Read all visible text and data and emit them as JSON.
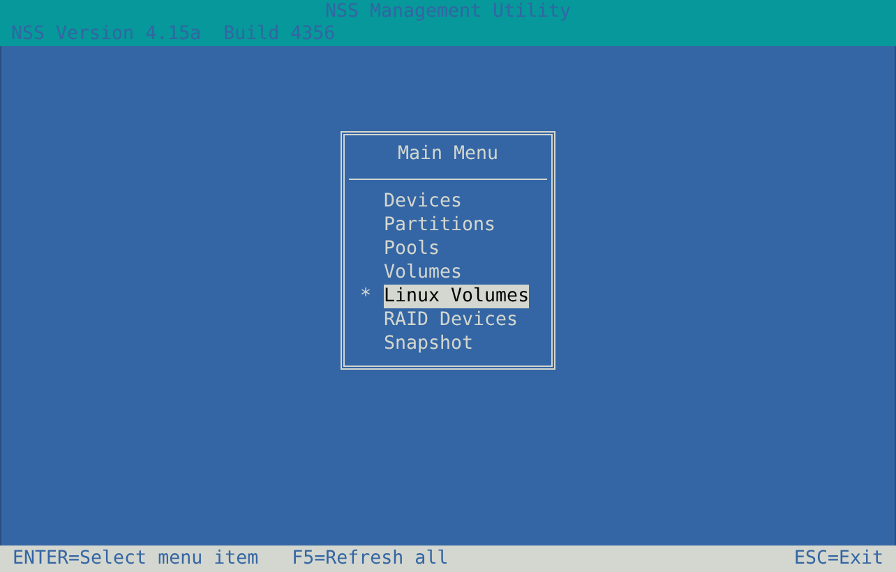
{
  "header": {
    "title": "NSS Management Utility",
    "version": "NSS Version 4.15a  Build 4356"
  },
  "menu": {
    "title": "Main Menu",
    "marker": "*",
    "items": [
      {
        "label": "Devices",
        "selected": false
      },
      {
        "label": "Partitions",
        "selected": false
      },
      {
        "label": "Pools",
        "selected": false
      },
      {
        "label": "Volumes",
        "selected": false
      },
      {
        "label": "Linux Volumes",
        "selected": true
      },
      {
        "label": "RAID Devices",
        "selected": false
      },
      {
        "label": "Snapshot",
        "selected": false
      }
    ]
  },
  "status_bar": {
    "left": [
      "ENTER=Select menu item",
      "F5=Refresh all"
    ],
    "right": "ESC=Exit"
  }
}
